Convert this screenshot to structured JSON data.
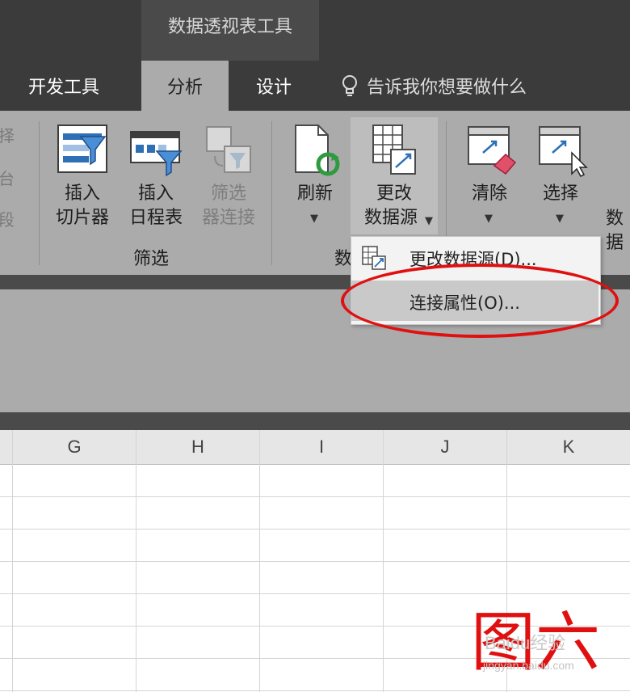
{
  "context_tab_label": "数据透视表工具",
  "tabs": {
    "developer": "开发工具",
    "analyze": "分析",
    "design": "设计"
  },
  "tell_me": "告诉我你想要做什么",
  "ribbon": {
    "partial_left": [
      "择",
      "台",
      "段"
    ],
    "insert_slicer": [
      "插入",
      "切片器"
    ],
    "insert_timeline": [
      "插入",
      "日程表"
    ],
    "filter_connections": [
      "筛选",
      "器连接"
    ],
    "filter_group": "筛选",
    "refresh": "刷新",
    "change_source": [
      "更改",
      "数据源"
    ],
    "data_group_partial": "数",
    "clear": "清除",
    "select": "选择",
    "partial_right": "数据"
  },
  "dropdown": {
    "items": [
      "更改数据源(D)...",
      "连接属性(O)..."
    ]
  },
  "columns": [
    "G",
    "H",
    "I",
    "J",
    "K"
  ],
  "watermark": {
    "label": "图六",
    "brand": "Baidu经验",
    "url": "jingyan.baidu.com"
  },
  "colors": {
    "highlight": "#e01010",
    "ribbon": "#ababab",
    "dark": "#3b3b3b"
  }
}
